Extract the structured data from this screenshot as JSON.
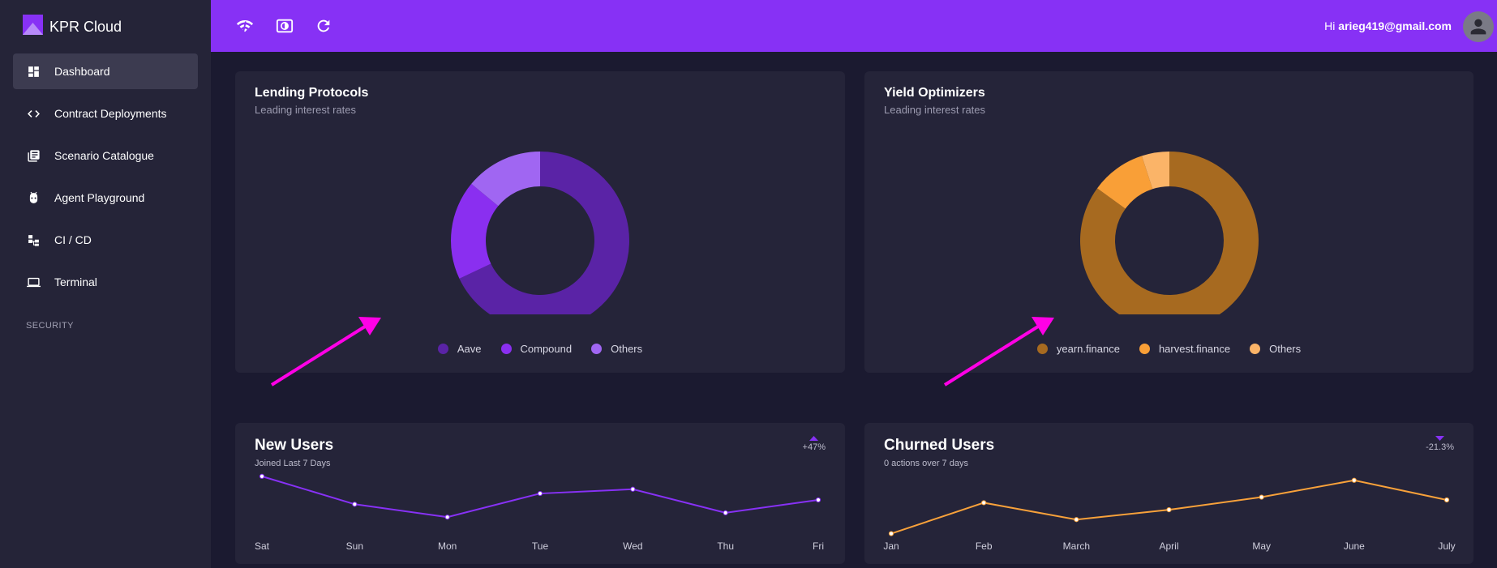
{
  "app": {
    "name": "KPR Cloud"
  },
  "sidebar": {
    "items": [
      {
        "label": "Dashboard",
        "icon": "dashboard-icon",
        "active": true
      },
      {
        "label": "Contract Deployments",
        "icon": "code-icon",
        "active": false
      },
      {
        "label": "Scenario Catalogue",
        "icon": "library-books-icon",
        "active": false
      },
      {
        "label": "Agent Playground",
        "icon": "robot-icon",
        "active": false
      },
      {
        "label": "CI / CD",
        "icon": "workflow-icon",
        "active": false
      },
      {
        "label": "Terminal",
        "icon": "laptop-icon",
        "active": false
      }
    ],
    "section_label": "SECURITY"
  },
  "topbar": {
    "icons": [
      "wifi-signal-icon",
      "brightness-icon",
      "refresh-icon"
    ],
    "greeting": "Hi",
    "email": "arieg419@gmail.com"
  },
  "cards": {
    "lending": {
      "title": "Lending Protocols",
      "subtitle": "Leading interest rates"
    },
    "yield": {
      "title": "Yield Optimizers",
      "subtitle": "Leading interest rates"
    },
    "new_users": {
      "title": "New Users",
      "subtitle": "Joined Last 7 Days",
      "trend": "+47%",
      "trend_direction": "up"
    },
    "churned_users": {
      "title": "Churned Users",
      "subtitle": "0 actions over 7 days",
      "trend": "-21.3%",
      "trend_direction": "down"
    }
  },
  "colors": {
    "accent": "#8731f5",
    "sidebar_bg": "#252438",
    "page_bg": "#1b1a30",
    "card_bg": "#252439",
    "annotation_arrow": "#ff00e6"
  },
  "chart_data": [
    {
      "id": "lending",
      "type": "pie",
      "donut": true,
      "categories": [
        "Aave",
        "Compound",
        "Others"
      ],
      "values": [
        68,
        18,
        14
      ],
      "colors": [
        "#5a23a6",
        "#8a2ff0",
        "#a066f2"
      ],
      "legend": "bottom"
    },
    {
      "id": "yield",
      "type": "pie",
      "donut": true,
      "categories": [
        "yearn.finance",
        "harvest.finance",
        "Others"
      ],
      "values": [
        85,
        10,
        5
      ],
      "colors": [
        "#a76a20",
        "#f99f37",
        "#fbb468"
      ],
      "legend": "bottom"
    },
    {
      "id": "new_users",
      "type": "line",
      "categories": [
        "Sat",
        "Sun",
        "Mon",
        "Tue",
        "Wed",
        "Thu",
        "Fri"
      ],
      "series": [
        {
          "values": [
            28,
            15,
            9,
            20,
            22,
            11,
            17
          ]
        }
      ],
      "ylim": [
        0,
        34
      ],
      "color": "#8731f5",
      "grid": false
    },
    {
      "id": "churned_users",
      "type": "line",
      "categories": [
        "Jan",
        "Feb",
        "March",
        "April",
        "May",
        "June",
        "July"
      ],
      "series": [
        {
          "values": [
            1,
            12,
            6,
            9.5,
            14,
            20,
            13
          ]
        }
      ],
      "ylim": [
        0,
        26
      ],
      "color": "#f8a13a",
      "grid": false
    }
  ]
}
